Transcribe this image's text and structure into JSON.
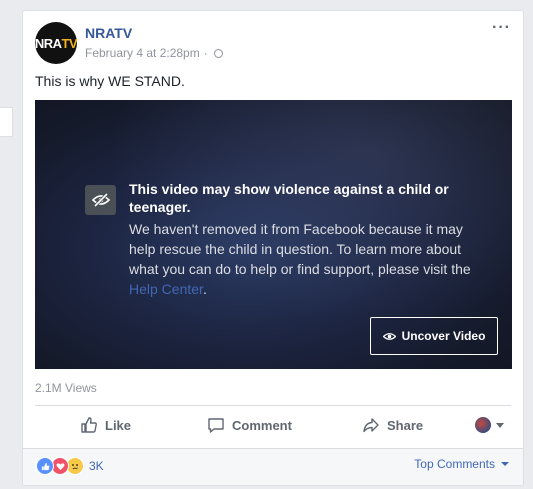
{
  "post": {
    "page_name": "NRATV",
    "avatar_text_a": "NRA",
    "avatar_text_b": "TV",
    "timestamp": "February 4 at 2:28pm",
    "separator": "·",
    "more_label": "···",
    "text": "This is why WE STAND."
  },
  "warning": {
    "title": "This video may show violence against a child or teenager.",
    "body": "We haven't removed it from Facebook because it may help rescue the child in question. To learn more about what you can do to help or find support, please visit the ",
    "link_text": "Help Center",
    "link_suffix": ".",
    "uncover_label": "Uncover Video"
  },
  "stats": {
    "views": "2.1M Views"
  },
  "actions": {
    "like": "Like",
    "comment": "Comment",
    "share": "Share"
  },
  "footer": {
    "reaction_count": "3K",
    "top_comments": "Top Comments"
  },
  "colors": {
    "link": "#4267b2",
    "like_blue": "#5890ff",
    "love_red": "#f25268",
    "sad_yellow": "#f7c948",
    "brand_yellow": "#f2b31b"
  }
}
